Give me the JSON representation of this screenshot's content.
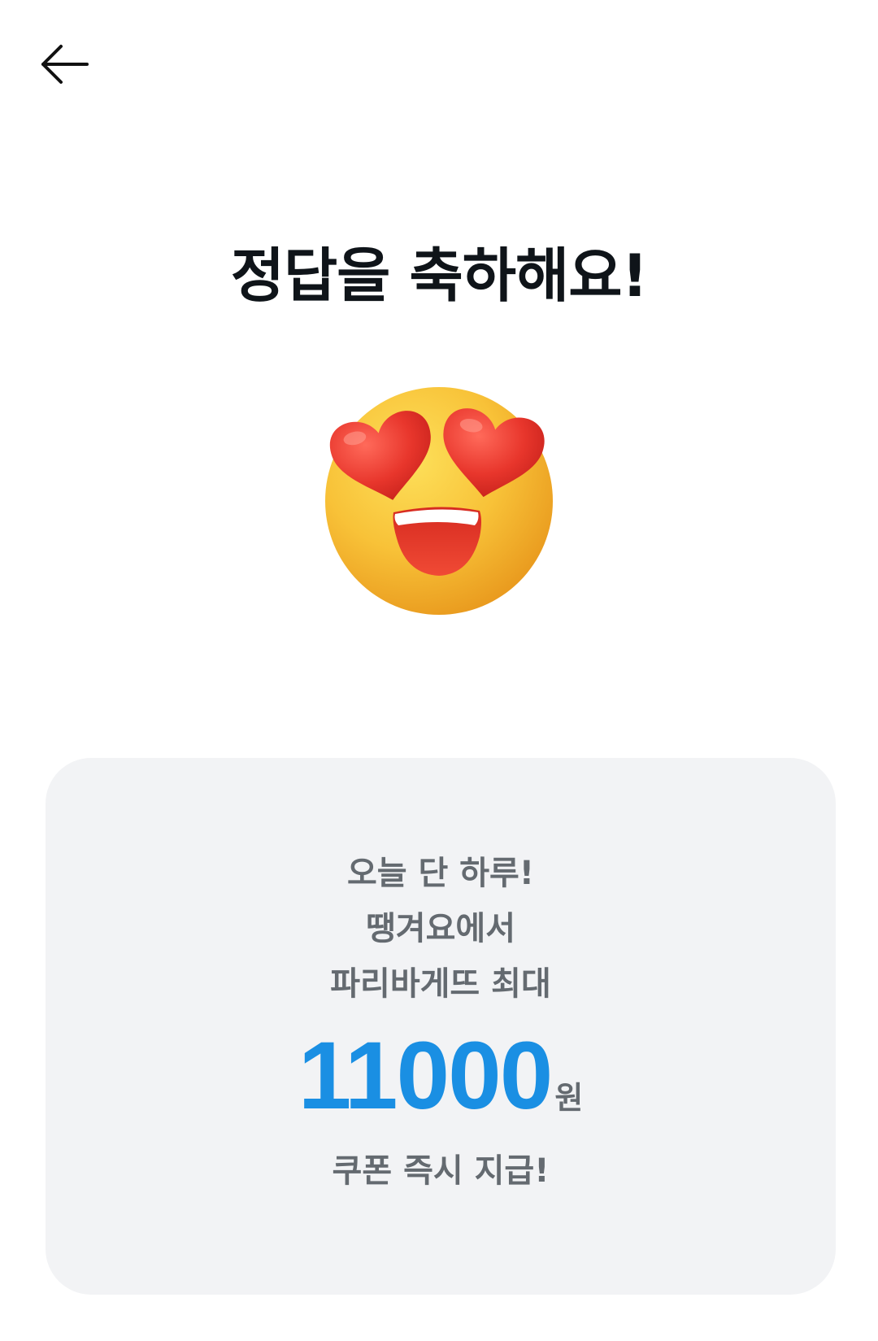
{
  "header": {
    "back_icon": "arrow-left-icon"
  },
  "title": "정답을 축하해요!",
  "emoji": "heart-eyes-smiling-face-icon",
  "promo": {
    "line1": "오늘 단 하루!",
    "line2": "땡겨요에서",
    "line3": "파리바게뜨 최대",
    "amount": "11000",
    "unit": "원",
    "line4": "쿠폰 즉시 지급!"
  },
  "colors": {
    "accent": "#1a8fe3",
    "card_background": "#f2f3f5",
    "title": "#0f1419",
    "body_text": "#646a70"
  }
}
